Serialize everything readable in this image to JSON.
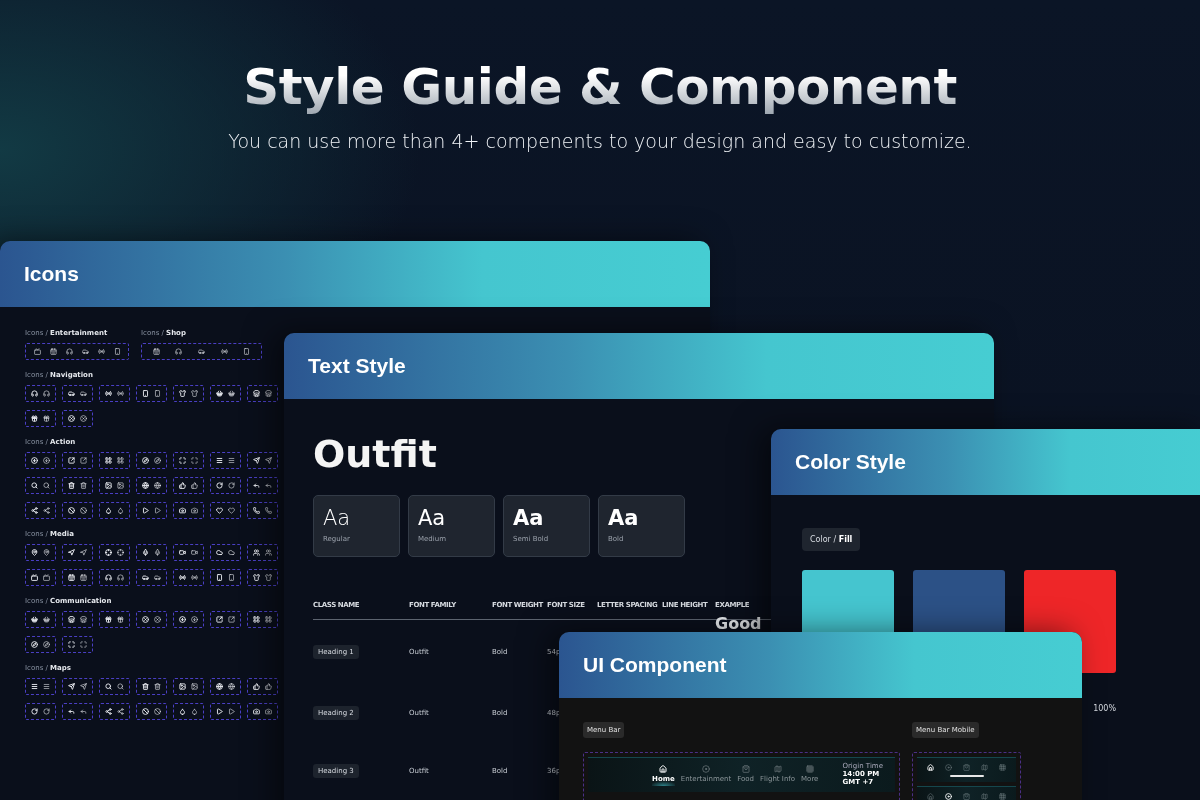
{
  "header": {
    "title": "Style Guide & Component",
    "subtitle": "You can use more than 4+ compenents to your design and easy to customize."
  },
  "icons_panel": {
    "title": "Icons",
    "rows": [
      [
        {
          "label": "Icons / **Entertainment**",
          "groups": [
            {
              "kind": "strip6"
            }
          ]
        },
        {
          "label": "Icons / **Shop**",
          "groups": [
            {
              "kind": "strip5"
            }
          ]
        }
      ],
      [
        {
          "label": "Icons / **Navigation**",
          "groups": [
            {
              "kind": "pair"
            },
            {
              "kind": "pair"
            },
            {
              "kind": "pair"
            },
            {
              "kind": "pair"
            },
            {
              "kind": "pair"
            },
            {
              "kind": "pair"
            },
            {
              "kind": "pair"
            },
            {
              "kind": "pair"
            },
            {
              "kind": "pair"
            }
          ]
        }
      ],
      [
        {
          "label": "Icons / **Action**",
          "groups": [
            {
              "kind": "pair"
            },
            {
              "kind": "pair"
            },
            {
              "kind": "pair"
            },
            {
              "kind": "pair"
            },
            {
              "kind": "pair"
            },
            {
              "kind": "pair"
            },
            {
              "kind": "pair"
            },
            {
              "kind": "pair"
            },
            {
              "kind": "pair"
            },
            {
              "kind": "pair"
            },
            {
              "kind": "pair"
            },
            {
              "kind": "pair"
            },
            {
              "kind": "pair"
            },
            {
              "kind": "pair"
            },
            {
              "kind": "pair"
            },
            {
              "kind": "pair"
            },
            {
              "kind": "pair"
            },
            {
              "kind": "pair"
            },
            {
              "kind": "pair"
            },
            {
              "kind": "pair"
            },
            {
              "kind": "pair"
            }
          ]
        }
      ],
      [
        {
          "label": "Icons / **Media**",
          "groups": [
            {
              "kind": "pair"
            },
            {
              "kind": "pair"
            },
            {
              "kind": "pair"
            },
            {
              "kind": "pair"
            },
            {
              "kind": "pair"
            },
            {
              "kind": "pair"
            },
            {
              "kind": "pair"
            },
            {
              "kind": "pair"
            },
            {
              "kind": "pair"
            },
            {
              "kind": "pair"
            },
            {
              "kind": "pair"
            },
            {
              "kind": "pair"
            },
            {
              "kind": "pair"
            },
            {
              "kind": "pair"
            }
          ]
        }
      ],
      [
        {
          "label": "Icons / **Communication**",
          "groups": [
            {
              "kind": "pair"
            },
            {
              "kind": "pair"
            },
            {
              "kind": "pair"
            },
            {
              "kind": "pair"
            },
            {
              "kind": "pair"
            },
            {
              "kind": "pair"
            },
            {
              "kind": "pair"
            },
            {
              "kind": "pair"
            },
            {
              "kind": "pair"
            }
          ]
        }
      ],
      [
        {
          "label": "Icons / **Maps**",
          "groups": [
            {
              "kind": "pair"
            },
            {
              "kind": "pair"
            },
            {
              "kind": "pair"
            },
            {
              "kind": "pair"
            },
            {
              "kind": "pair"
            },
            {
              "kind": "pair"
            },
            {
              "kind": "pair"
            },
            {
              "kind": "pair"
            },
            {
              "kind": "pair"
            },
            {
              "kind": "pair"
            },
            {
              "kind": "pair"
            },
            {
              "kind": "pair"
            },
            {
              "kind": "pair"
            },
            {
              "kind": "pair"
            }
          ]
        }
      ]
    ]
  },
  "text_style_panel": {
    "title": "Text Style",
    "font_name": "Outfit",
    "weights": [
      {
        "sample": "Aa",
        "label": "Regular",
        "kind": "regular"
      },
      {
        "sample": "Aa",
        "label": "Medium",
        "kind": "medium"
      },
      {
        "sample": "Aa",
        "label": "Semi Bold",
        "kind": "semibold"
      },
      {
        "sample": "Aa",
        "label": "Bold",
        "kind": "bold"
      }
    ],
    "table": {
      "columns": [
        "CLASS NAME",
        "FONT FAMILY",
        "FONT WEIGHT",
        "FONT SIZE",
        "LETTER SPACING",
        "LINE HEIGHT",
        "EXAMPLE"
      ],
      "rows": [
        {
          "class_name": "Heading 1",
          "font_family": "Outfit",
          "font_weight": "Bold",
          "font_size": "54p",
          "example": "Good"
        },
        {
          "class_name": "Heading 2",
          "font_family": "Outfit",
          "font_weight": "Bold",
          "font_size": "48p"
        },
        {
          "class_name": "Heading 3",
          "font_family": "Outfit",
          "font_weight": "Bold",
          "font_size": "36p"
        }
      ]
    }
  },
  "color_style_panel": {
    "title": "Color Style",
    "tag": "Color / **Fill**",
    "swatches": [
      {
        "color": "#45c5cf"
      },
      {
        "color": "#2c5186"
      },
      {
        "color": "#ee2628",
        "label": "100%"
      }
    ]
  },
  "ui_component_panel": {
    "title": "UI Component",
    "menu_bar": {
      "label": "Menu Bar",
      "items": [
        {
          "label": "Home",
          "selected": true
        },
        {
          "label": "Entertainment",
          "selected": false
        },
        {
          "label": "Food",
          "selected": false
        },
        {
          "label": "Flight Info",
          "selected": false
        },
        {
          "label": "More",
          "selected": false
        }
      ],
      "time": {
        "caption": "Origin Time",
        "value": "14:00 PM",
        "zone": "GMT +7"
      }
    },
    "menu_bar_mobile": {
      "label": "Menu Bar Mobile",
      "bars": [
        {
          "items": [
            {
              "selected": true
            },
            {
              "selected": false
            },
            {
              "selected": false
            },
            {
              "selected": false
            },
            {
              "selected": false
            }
          ]
        },
        {
          "items": [
            {
              "selected": false
            },
            {
              "selected": true
            },
            {
              "selected": false
            },
            {
              "selected": false
            },
            {
              "selected": false
            }
          ]
        }
      ]
    }
  }
}
